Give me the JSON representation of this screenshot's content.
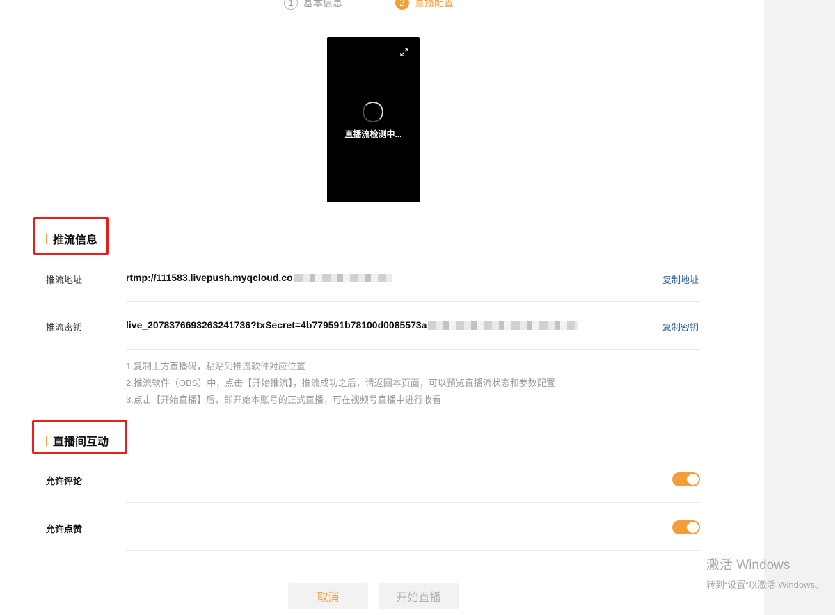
{
  "steps": [
    {
      "number": "1",
      "label": "基本信息"
    },
    {
      "number": "2",
      "label": "直播配置"
    }
  ],
  "preview": {
    "status_text": "直播流检测中..."
  },
  "push_info": {
    "title": "推流信息",
    "address_label": "推流地址",
    "address_value": "rtmp://111583.livepush.myqcloud.co",
    "copy_address": "复制地址",
    "key_label": "推流密钥",
    "key_value": "live_2078376693263241736?txSecret=4b779591b78100d0085573a",
    "copy_key": "复制密钥"
  },
  "tips": [
    "1.复制上方直播码，粘贴到推流软件对应位置",
    "2.推流软件（OBS）中，点击【开始推流】，推流成功之后，请返回本页面，可以预览直播流状态和参数配置",
    "3.点击【开始直播】后，即开始本账号的正式直播，可在视频号直播中进行收看"
  ],
  "interaction": {
    "title": "直播间互动",
    "allow_comments_label": "允许评论",
    "allow_comments": true,
    "allow_likes_label": "允许点赞",
    "allow_likes": true
  },
  "buttons": {
    "cancel": "取消",
    "start": "开始直播"
  },
  "watermark": {
    "title": "激活 Windows",
    "subtitle": "转到“设置”以激活 Windows。"
  },
  "colors": {
    "accent": "#f59d3b",
    "link": "#2c5aa0",
    "highlight": "#ea1d1d"
  }
}
